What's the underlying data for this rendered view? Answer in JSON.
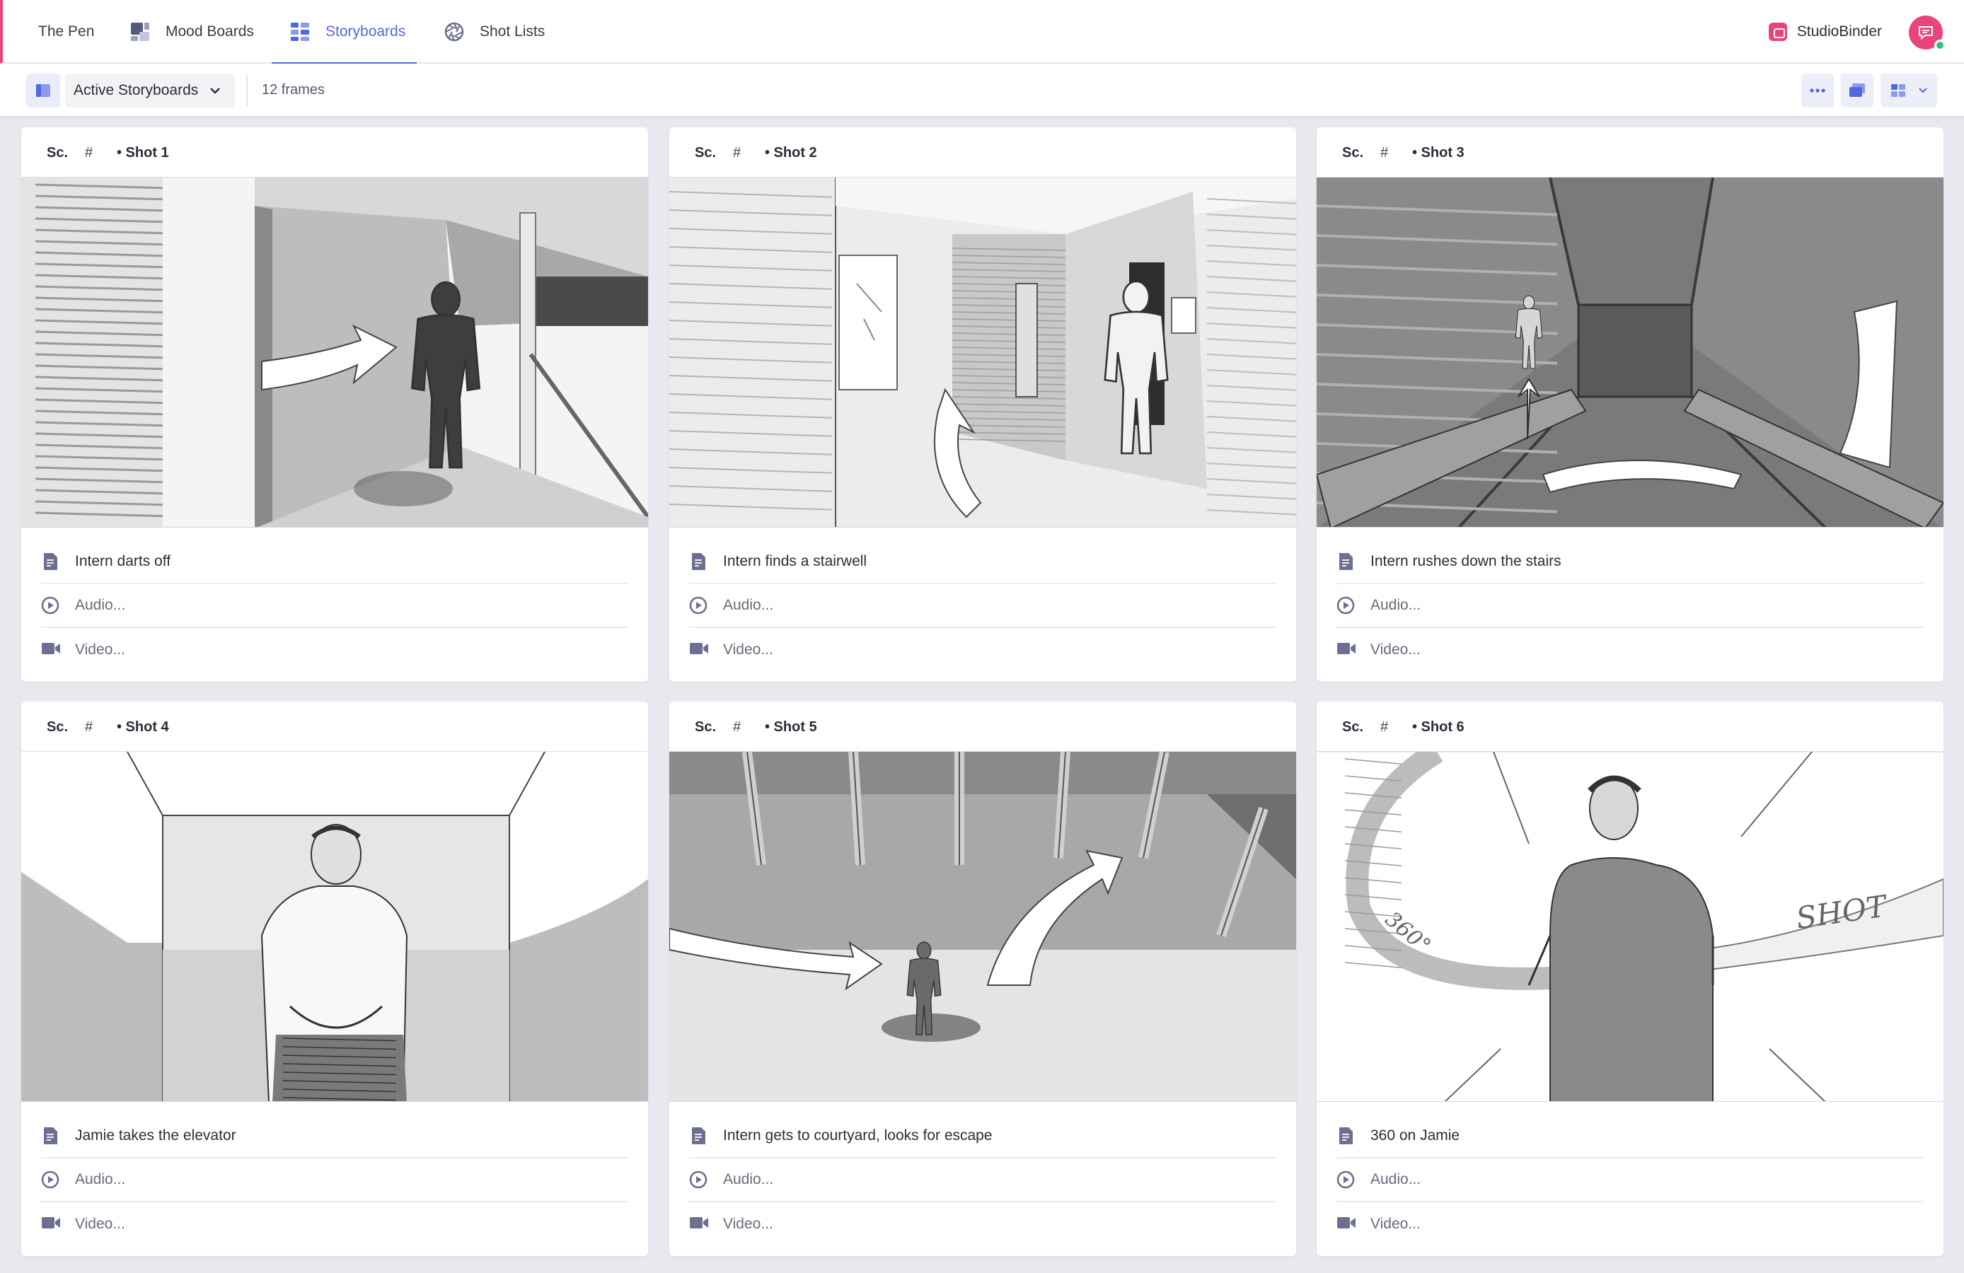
{
  "nav": {
    "tabs": [
      {
        "label": "The Pen",
        "icon": "none",
        "active": false
      },
      {
        "label": "Mood Boards",
        "icon": "moodboard-icon",
        "active": false
      },
      {
        "label": "Storyboards",
        "icon": "storyboard-icon",
        "active": true
      },
      {
        "label": "Shot Lists",
        "icon": "aperture-icon",
        "active": false
      }
    ],
    "brand": "StudioBinder",
    "accent": "#5468dd",
    "brand_color": "#e8457c"
  },
  "toolbar": {
    "dropdown_label": "Active Storyboards",
    "frames_count": "12 frames"
  },
  "card_labels": {
    "scene": "Sc.",
    "scene_number": "#",
    "audio_placeholder": "Audio...",
    "video_placeholder": "Video..."
  },
  "frames": [
    {
      "shot": "• Shot  1",
      "description": "Intern darts off"
    },
    {
      "shot": "• Shot  2",
      "description": "Intern finds a stairwell"
    },
    {
      "shot": "• Shot  3",
      "description": "Intern rushes down the stairs"
    },
    {
      "shot": "• Shot  4",
      "description": "Jamie takes the elevator"
    },
    {
      "shot": "• Shot  5",
      "description": "Intern gets to courtyard, looks for escape"
    },
    {
      "shot": "• Shot  6",
      "description": "360 on Jamie"
    }
  ],
  "sketch_annotations": {
    "shot6_rotation": "360°",
    "shot6_arrow": "SHOT"
  }
}
